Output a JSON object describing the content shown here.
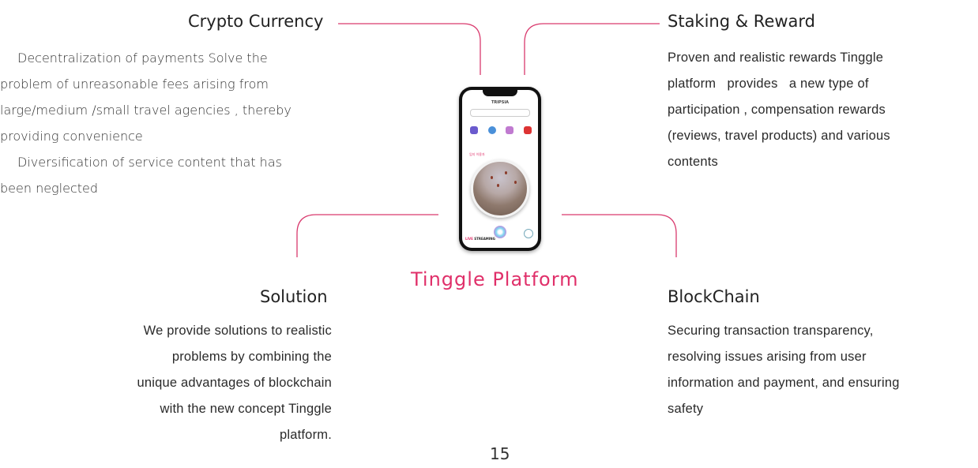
{
  "crypto": {
    "title": "Crypto Currency",
    "line1": "Decentralization   of payments  Solve the",
    "line2": "problem  of unreasonable   fees arising  from",
    "line3": "large/medium /small travel agencies , thereby",
    "line4": "providing convenience",
    "line5": "Diversification   of service  content  that has",
    "line6": "been neglected"
  },
  "staking": {
    "title": "Staking & Reward",
    "lines": [
      "Proven and realistic rewards Tinggle",
      "platform   provides   a new type of",
      "participation , compensation rewards",
      "(reviews, travel products) and various",
      "contents"
    ]
  },
  "solution": {
    "title": "Solution",
    "lines": [
      "We provide solutions to realistic",
      "problems by combining the",
      "unique advantages of blockchain",
      "with the new concept Tinggle",
      "platform."
    ]
  },
  "blockchain": {
    "title": "BlockChain",
    "lines": [
      "Securing transaction transparency,",
      "resolving issues arising from user",
      "information and payment, and ensuring",
      "safety"
    ]
  },
  "center": {
    "platform_label": "Tinggle Platform",
    "app_name": "TRIPSIA",
    "section_label": "임지 이용자",
    "live_word": "LIVE",
    "streaming_word": "STREAMING"
  },
  "page_number": "15",
  "colors": {
    "accent": "#e0306a",
    "line": "#d93a6e"
  }
}
